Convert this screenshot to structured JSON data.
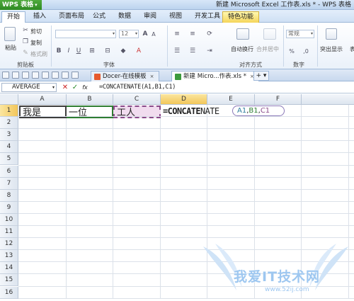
{
  "title_bar": {
    "app_name": "WPS 表格",
    "window_title": "新建 Microsoft Excel 工作表.xls * - WPS 表格"
  },
  "menu": {
    "tabs": [
      "开始",
      "插入",
      "页面布局",
      "公式",
      "数据",
      "审阅",
      "视图",
      "开发工具",
      "特色功能"
    ],
    "active_tab": "开始"
  },
  "ribbon": {
    "paste_label": "粘贴",
    "cut_label": "剪切",
    "copy_label": "复制",
    "format_painter_label": "格式刷",
    "clipboard_group": "剪贴板",
    "font_size": "12",
    "font_group": "字体",
    "wrap_label": "自动换行",
    "merge_label": "合并居中",
    "alignment_group": "对齐方式",
    "number_format": "常规",
    "number_group": "数字",
    "highlight_label": "突出显示",
    "more_label": "表"
  },
  "doc_tabs": [
    {
      "label": "Docer-在线模板",
      "close": "×"
    },
    {
      "label": "新建 Micro...作表.xls *",
      "close": "×"
    }
  ],
  "tab_add_label": "+ ▾",
  "formula_bar": {
    "name_box": "AVERAGE",
    "cancel": "✕",
    "confirm": "✓",
    "fx": "fx",
    "formula": "=CONCATENATE(A1,B1,C1)"
  },
  "grid": {
    "columns": [
      "A",
      "B",
      "C",
      "D",
      "E",
      "F"
    ],
    "selected_column": "D",
    "rows": [
      "1",
      "2",
      "3",
      "4",
      "5",
      "6",
      "7",
      "8",
      "9",
      "10",
      "11",
      "12",
      "13",
      "14",
      "15",
      "16"
    ],
    "selected_row": "1",
    "cells": {
      "A1": "我是",
      "B1": "一位",
      "C1": "工人",
      "D1_bold": "=CONCATE",
      "D1_rest": "NATE"
    },
    "tooltip_args": [
      "A1",
      "B1",
      "C1"
    ]
  },
  "watermark": {
    "text": "我爱IT技术网",
    "url": "www.52ij.com"
  }
}
